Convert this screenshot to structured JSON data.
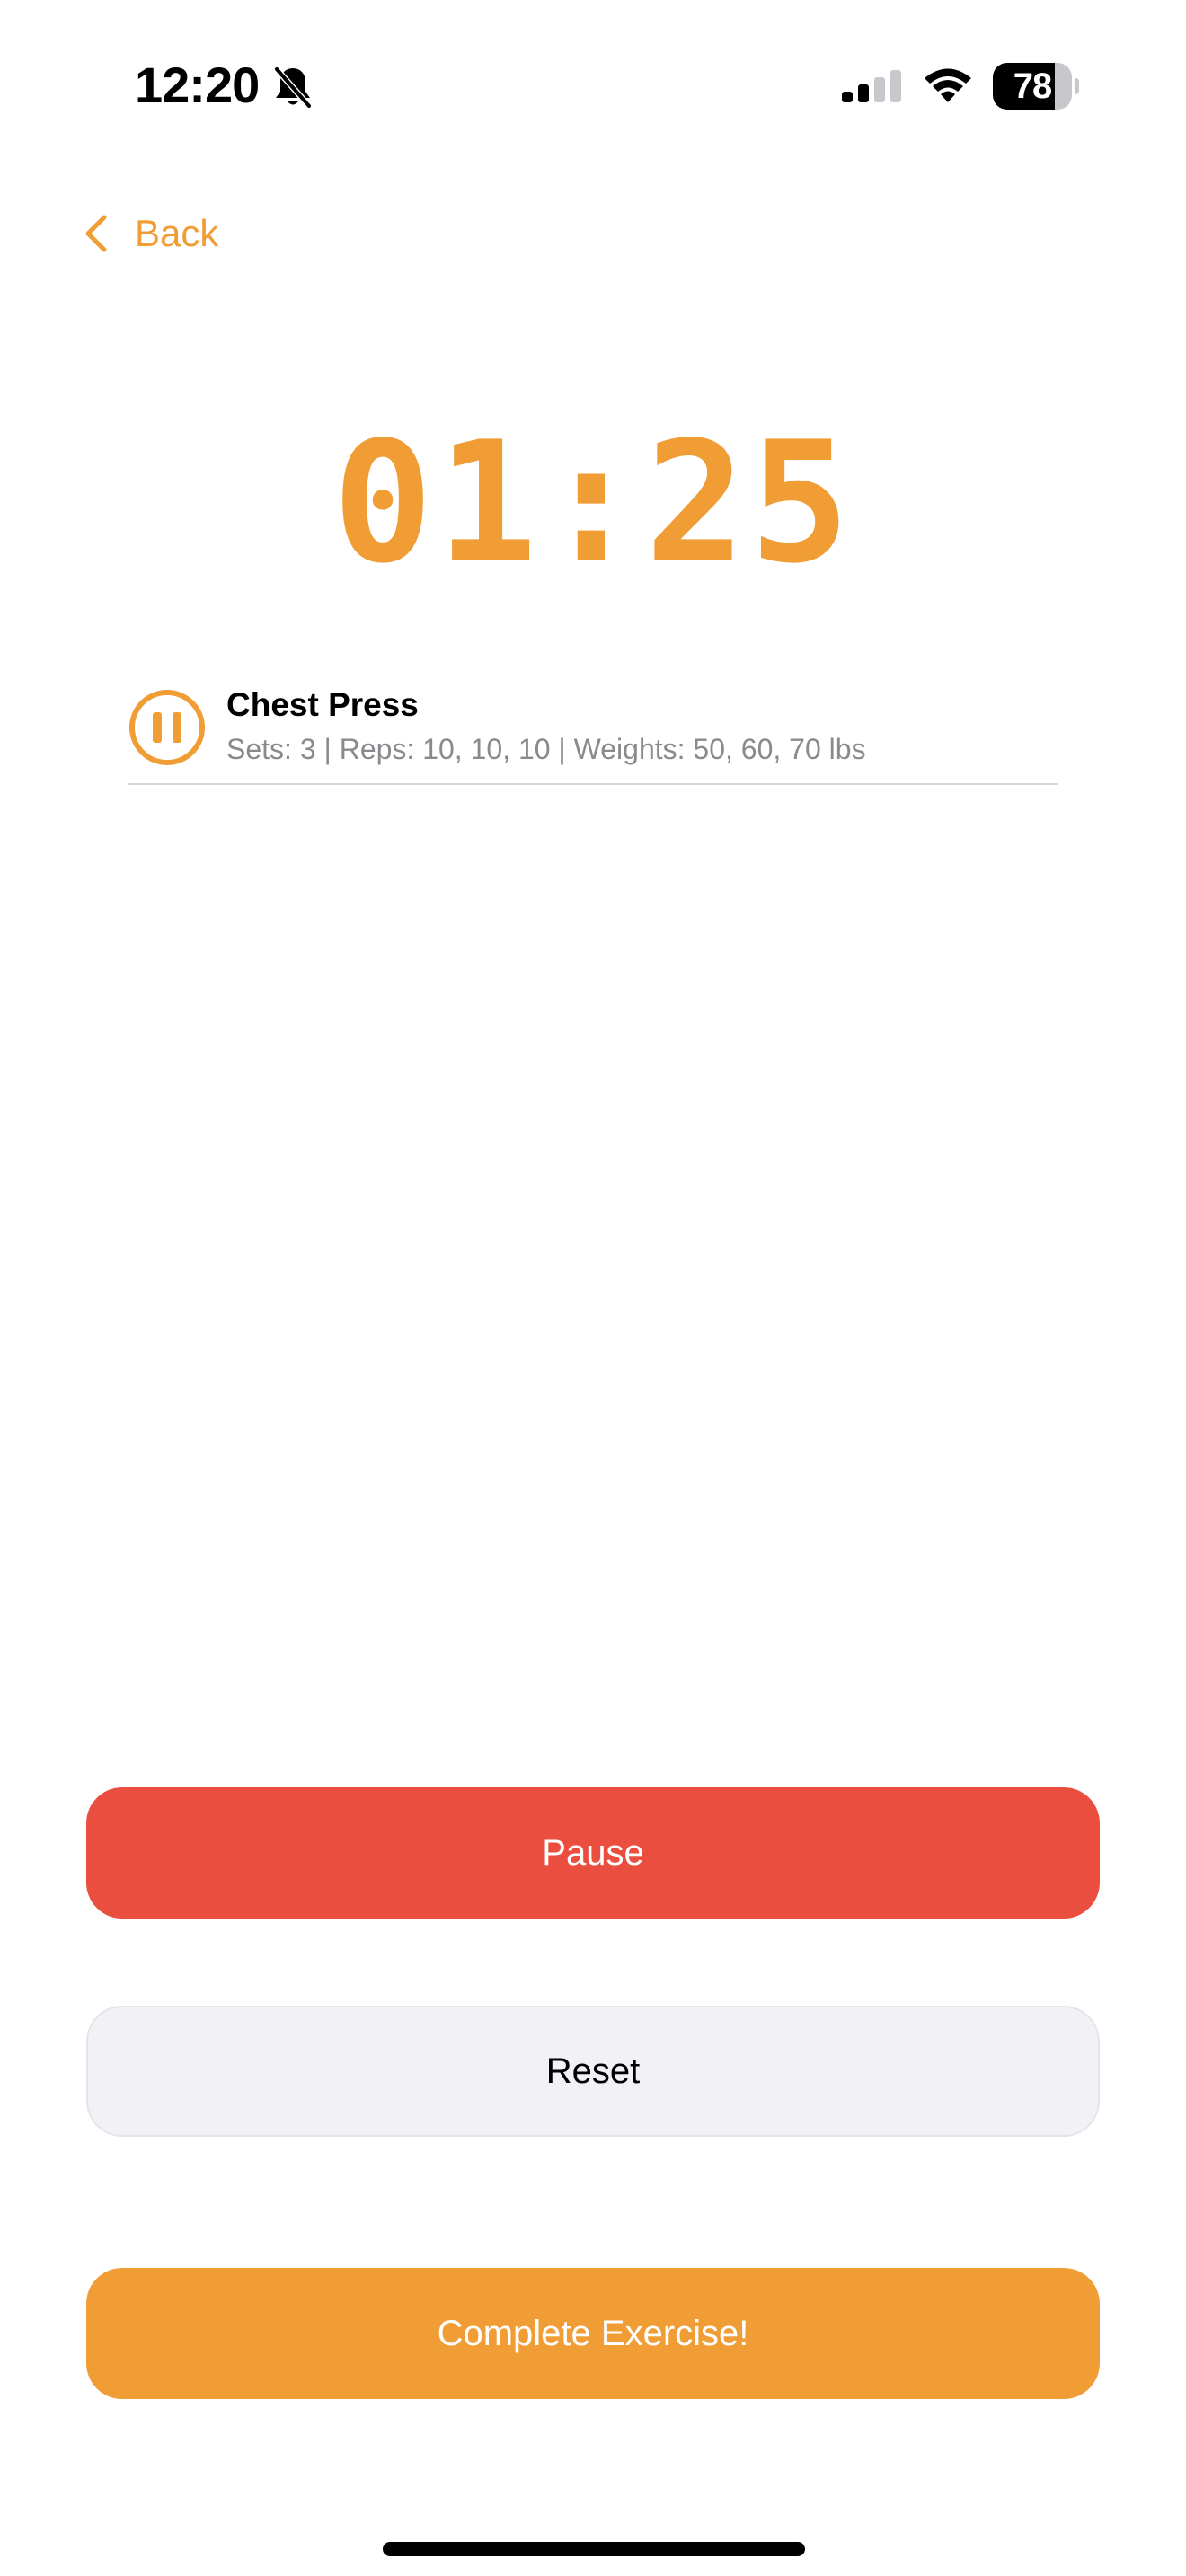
{
  "status_bar": {
    "time": "12:20",
    "battery_level": "78",
    "battery_fraction": 0.78,
    "signal_bars_active": 2,
    "signal_bars_total": 4,
    "icons": [
      "bell-slash-icon",
      "cellular-signal-icon",
      "wifi-icon",
      "battery-icon"
    ]
  },
  "nav": {
    "back_label": "Back",
    "back_icon": "chevron-left-icon"
  },
  "timer": {
    "display": "01:25"
  },
  "exercise": {
    "name": "Chest Press",
    "details": "Sets: 3 | Reps: 10, 10, 10 | Weights: 50, 60, 70 lbs",
    "status_icon": "pause-circle-icon"
  },
  "actions": {
    "pause_label": "Pause",
    "reset_label": "Reset",
    "complete_label": "Complete Exercise!"
  },
  "colors": {
    "accent": "#F09D36",
    "pause": "#EA4E3F",
    "reset_bg": "#F1F1F6",
    "secondary_text": "#8A8A8E"
  }
}
